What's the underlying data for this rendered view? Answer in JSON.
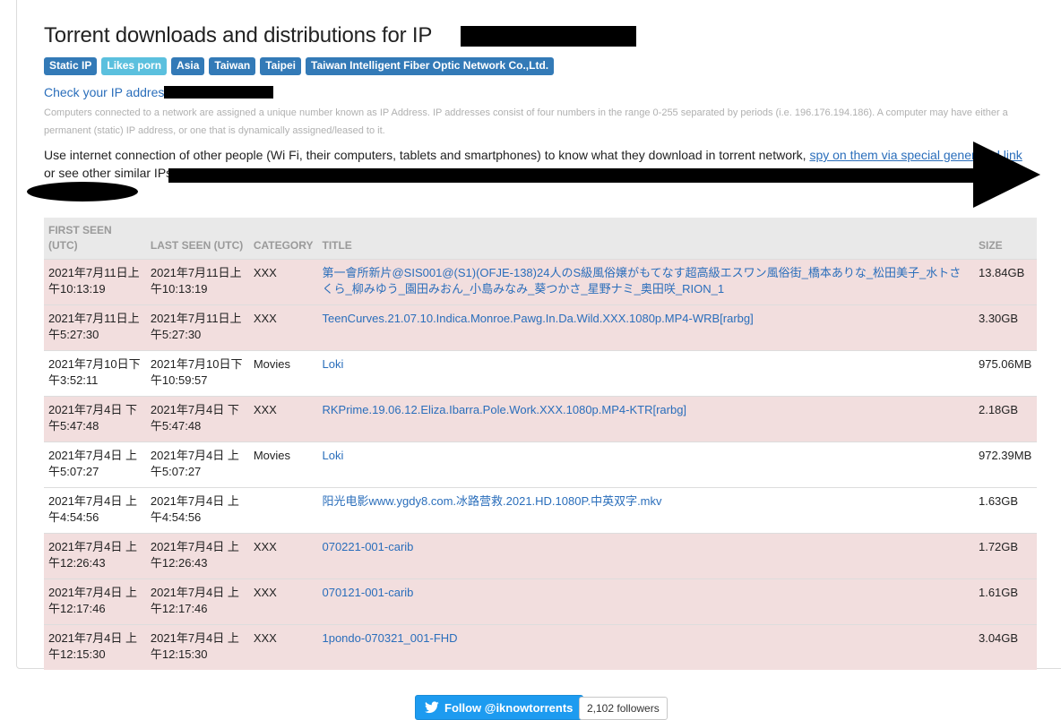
{
  "page": {
    "title": "Torrent downloads and distributions for IP"
  },
  "tags": [
    {
      "label": "Static IP",
      "style": "primary"
    },
    {
      "label": "Likes porn",
      "style": "info"
    },
    {
      "label": "Asia",
      "style": "primary"
    },
    {
      "label": "Taiwan",
      "style": "primary"
    },
    {
      "label": "Taipei",
      "style": "primary"
    },
    {
      "label": "Taiwan Intelligent Fiber Optic Network Co.,Ltd.",
      "style": "primary"
    }
  ],
  "check_ip": {
    "label": "Check your IP addres"
  },
  "description": "Computers connected to a network are assigned a unique number known as IP Address. IP addresses consist of four numbers in the range 0-255 separated by periods (i.e. 196.176.194.186). A computer may have either a permanent (static) IP address, or one that is dynamically assigned/leased to it.",
  "promo": {
    "text": "Use internet connection of other people (Wi Fi, their computers, tablets and smartphones) to know what they download in torrent network, ",
    "link": "spy on them via special generated link",
    "text2": "or see other similar IPs"
  },
  "blob_link": "y",
  "table": {
    "headers": {
      "first_seen": "FIRST SEEN (UTC)",
      "last_seen": "LAST SEEN (UTC)",
      "category": "CATEGORY",
      "title": "TITLE",
      "size": "SIZE"
    },
    "rows": [
      {
        "first": "2021年7月11日上午10:13:19",
        "last": "2021年7月11日上午10:13:19",
        "category": "XXX",
        "title": "第一會所新片@SIS001@(S1)(OFJE-138)24人のS級風俗嬢がもてなす超高級エスワン風俗街_橋本ありな_松田美子_水トさくら_柳みゆう_園田みおん_小島みなみ_葵つかさ_星野ナミ_奥田咲_RION_1",
        "size": "13.84GB"
      },
      {
        "first": "2021年7月11日上午5:27:30",
        "last": "2021年7月11日上午5:27:30",
        "category": "XXX",
        "title": "TeenCurves.21.07.10.Indica.Monroe.Pawg.In.Da.Wild.XXX.1080p.MP4-WRB[rarbg]",
        "size": "3.30GB"
      },
      {
        "first": "2021年7月10日下午3:52:11",
        "last": "2021年7月10日下午10:59:57",
        "category": "Movies",
        "title": "Loki",
        "size": "975.06MB"
      },
      {
        "first": "2021年7月4日 下午5:47:48",
        "last": "2021年7月4日 下午5:47:48",
        "category": "XXX",
        "title": "RKPrime.19.06.12.Eliza.Ibarra.Pole.Work.XXX.1080p.MP4-KTR[rarbg]",
        "size": "2.18GB"
      },
      {
        "first": "2021年7月4日 上午5:07:27",
        "last": "2021年7月4日 上午5:07:27",
        "category": "Movies",
        "title": "Loki",
        "size": "972.39MB"
      },
      {
        "first": "2021年7月4日 上午4:54:56",
        "last": "2021年7月4日 上午4:54:56",
        "category": "",
        "title": "阳光电影www.ygdy8.com.冰路营救.2021.HD.1080P.中英双字.mkv",
        "size": "1.63GB"
      },
      {
        "first": "2021年7月4日 上午12:26:43",
        "last": "2021年7月4日 上午12:26:43",
        "category": "XXX",
        "title": "070221-001-carib",
        "size": "1.72GB"
      },
      {
        "first": "2021年7月4日 上午12:17:46",
        "last": "2021年7月4日 上午12:17:46",
        "category": "XXX",
        "title": "070121-001-carib",
        "size": "1.61GB"
      },
      {
        "first": "2021年7月4日 上午12:15:30",
        "last": "2021年7月4日 上午12:15:30",
        "category": "XXX",
        "title": "1pondo-070321_001-FHD",
        "size": "3.04GB"
      }
    ]
  },
  "footer": {
    "follow_label": "Follow @iknowtorrents",
    "followers": "2,102 followers"
  },
  "colors": {
    "xxx_row": "#f2dede",
    "link": "#2a6ebb",
    "tag": "#337ab7",
    "tag_info": "#5bc0de",
    "twitter": "#1d9bf0"
  }
}
